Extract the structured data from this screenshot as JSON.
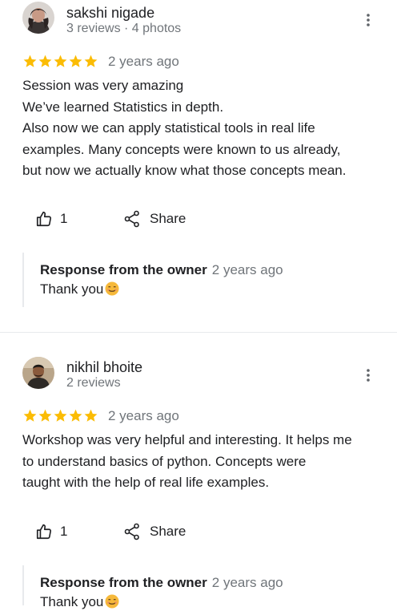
{
  "reviews": [
    {
      "reviewer": "sakshi nigade",
      "meta": "3 reviews · 4 photos",
      "rating": 5,
      "date": "2 years ago",
      "lines": [
        "Session was very amazing",
        "We’ve learned Statistics in depth.",
        "Also now we can apply statistical tools in real life",
        "examples. Many concepts were known to us already,",
        "but now we actually know what those concepts mean."
      ],
      "likes": "1",
      "share_label": "Share",
      "response_title": "Response from the owner",
      "response_date": "2 years ago",
      "response_text": "Thank you"
    },
    {
      "reviewer": "nikhil bhoite",
      "meta": "2 reviews",
      "rating": 5,
      "date": "2 years ago",
      "lines": [
        "Workshop was very helpful and interesting. It helps me",
        "to understand basics of python.  Concepts were",
        "taught with the help of real life examples."
      ],
      "likes": "1",
      "share_label": "Share",
      "response_title": "Response from the owner",
      "response_date": "2 years ago",
      "response_text": "Thank you"
    }
  ],
  "colors": {
    "star": "#fbbc04",
    "muted": "#70757a",
    "text": "#202124"
  }
}
